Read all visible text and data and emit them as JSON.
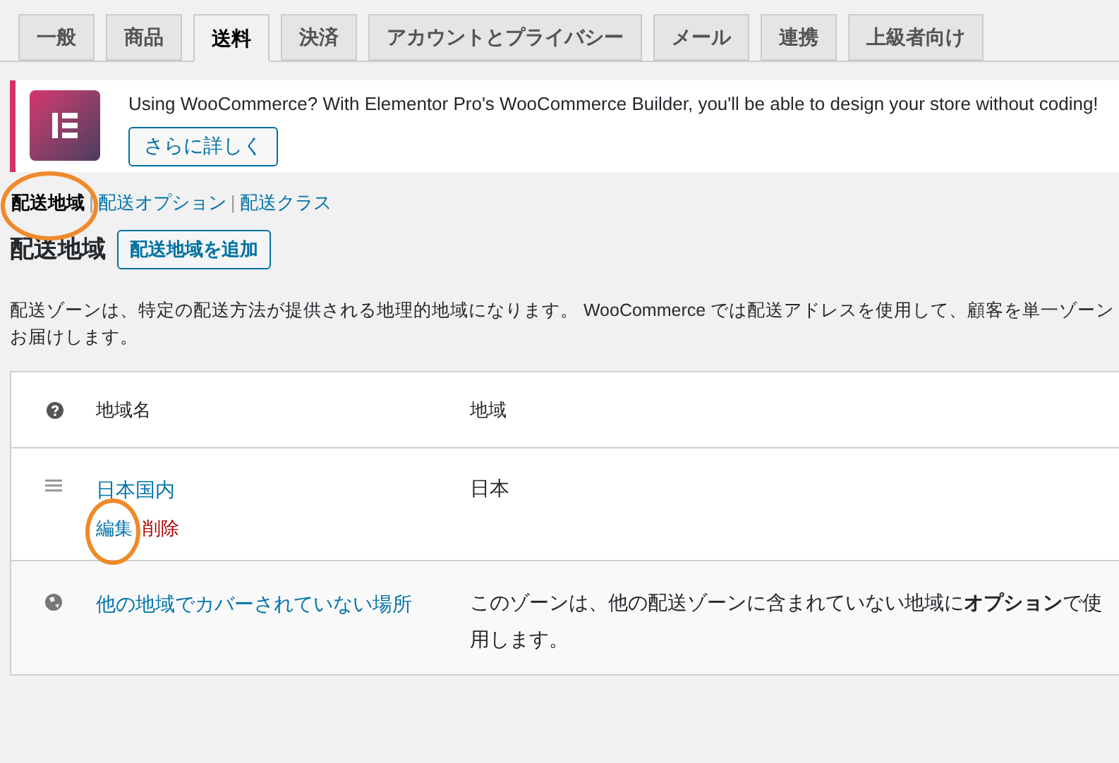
{
  "tabs": [
    {
      "label": "一般",
      "selected": false
    },
    {
      "label": "商品",
      "selected": false
    },
    {
      "label": "送料",
      "selected": true
    },
    {
      "label": "決済",
      "selected": false
    },
    {
      "label": "アカウントとプライバシー",
      "selected": false
    },
    {
      "label": "メール",
      "selected": false
    },
    {
      "label": "連携",
      "selected": false
    },
    {
      "label": "上級者向け",
      "selected": false
    }
  ],
  "notice": {
    "text": "Using WooCommerce? With Elementor Pro's WooCommerce Builder, you'll be able to design your store without coding!",
    "button": "さらに詳しく"
  },
  "subnav": [
    {
      "label": "配送地域",
      "selected": true
    },
    {
      "label": "配送オプション",
      "selected": false,
      "separator": "|"
    },
    {
      "label": "配送クラス",
      "selected": false,
      "separator": "|"
    }
  ],
  "heading": "配送地域",
  "add_button": "配送地域を追加",
  "description": [
    "配送ゾーンは、特定の配送方法が提供される地理的地域になります。 WooCommerce では配送アドレスを使用して、顧客を単一ゾーン",
    "お届けします。"
  ],
  "table": {
    "columns": [
      "地域名",
      "地域"
    ],
    "rows": [
      {
        "kind": "zone",
        "name": "日本国内",
        "region": "日本",
        "actions": [
          {
            "label": "編集",
            "kind": "edit"
          },
          {
            "label": "削除",
            "kind": "delete"
          }
        ]
      },
      {
        "kind": "fallback",
        "name": "他の地域でカバーされていない場所",
        "region": "このゾーンは、他の配送ゾーンに含まれていない地域に**オプション**で使用します。"
      }
    ]
  }
}
